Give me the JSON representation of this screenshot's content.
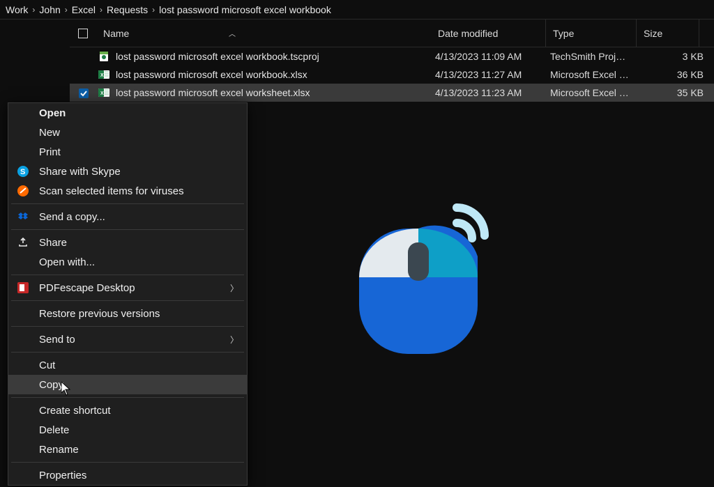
{
  "breadcrumb": [
    "Work",
    "John",
    "Excel",
    "Requests",
    "lost password microsoft excel workbook"
  ],
  "columns": {
    "name": "Name",
    "date": "Date modified",
    "type": "Type",
    "size": "Size"
  },
  "files": [
    {
      "icon": "tscproj",
      "name": "lost password microsoft excel workbook.tscproj",
      "date": "4/13/2023 11:09 AM",
      "type": "TechSmith Proj…",
      "size": "3 KB",
      "selected": false
    },
    {
      "icon": "xlsx",
      "name": "lost password microsoft excel workbook.xlsx",
      "date": "4/13/2023 11:27 AM",
      "type": "Microsoft Excel …",
      "size": "36 KB",
      "selected": false
    },
    {
      "icon": "xlsx",
      "name": "lost password microsoft excel worksheet.xlsx",
      "date": "4/13/2023 11:23 AM",
      "type": "Microsoft Excel …",
      "size": "35 KB",
      "selected": true
    }
  ],
  "context_menu": {
    "groups": [
      [
        {
          "label": "Open",
          "bold": true
        },
        {
          "label": "New"
        },
        {
          "label": "Print"
        },
        {
          "label": "Share with Skype",
          "icon": "skype"
        },
        {
          "label": "Scan selected items for viruses",
          "icon": "avast"
        }
      ],
      [
        {
          "label": "Send a copy...",
          "icon": "dropbox"
        }
      ],
      [
        {
          "label": "Share",
          "icon": "share"
        },
        {
          "label": "Open with..."
        }
      ],
      [
        {
          "label": "PDFescape Desktop",
          "icon": "pdfescape",
          "submenu": true
        }
      ],
      [
        {
          "label": "Restore previous versions"
        }
      ],
      [
        {
          "label": "Send to",
          "submenu": true
        }
      ],
      [
        {
          "label": "Cut"
        },
        {
          "label": "Copy",
          "hover": true
        }
      ],
      [
        {
          "label": "Create shortcut"
        },
        {
          "label": "Delete"
        },
        {
          "label": "Rename"
        }
      ],
      [
        {
          "label": "Properties"
        }
      ]
    ]
  }
}
